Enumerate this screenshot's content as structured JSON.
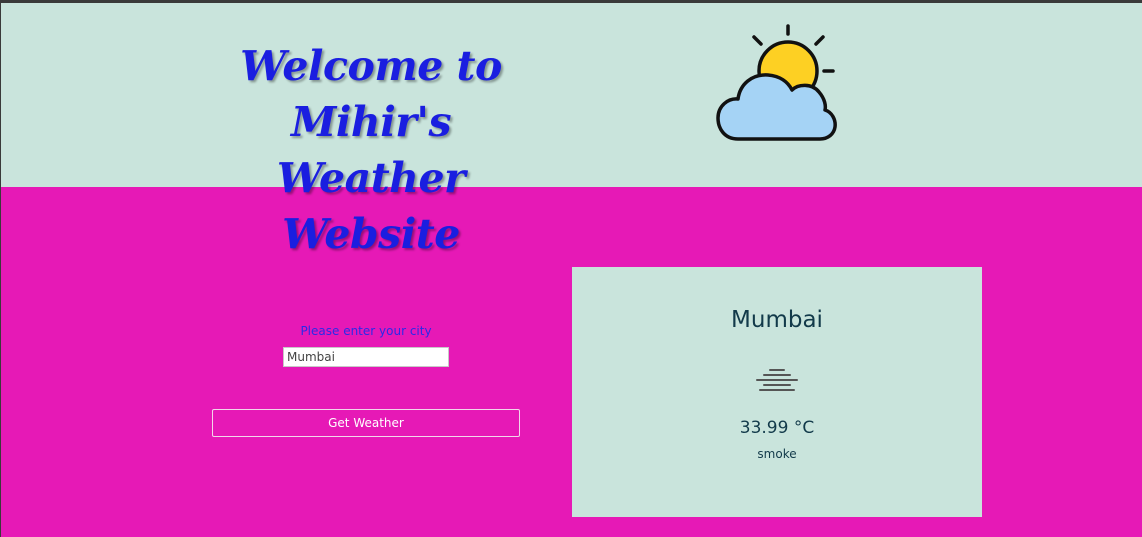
{
  "header": {
    "title_line1": "Welcome to Mihir's",
    "title_line2": "Weather Website",
    "logo_icon": "partly-cloudy-sun-icon"
  },
  "form": {
    "label": "Please enter your city",
    "input_value": "Mumbai",
    "input_placeholder": "",
    "button_label": "Get Weather"
  },
  "weather_card": {
    "city": "Mumbai",
    "icon": "mist-icon",
    "temperature": "33.99 °C",
    "description": "smoke"
  },
  "colors": {
    "page_background": "#e619b6",
    "header_background": "#c9e4dc",
    "card_background": "#c9e4dc",
    "title_color": "#1a1ee0",
    "label_color": "#2a2ae8",
    "card_text_color": "#123a4a"
  }
}
